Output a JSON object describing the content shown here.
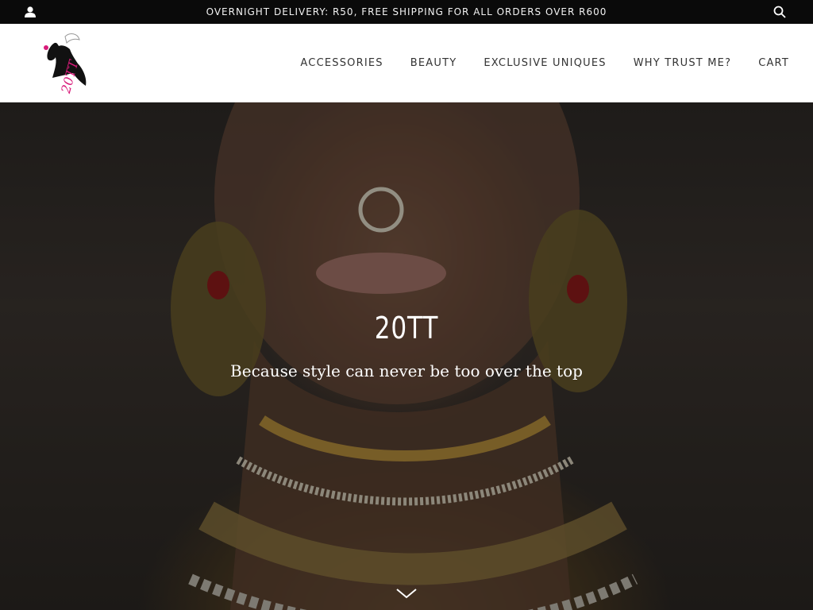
{
  "topbar": {
    "announcement": "OVERNIGHT DELIVERY: R50, FREE SHIPPING FOR ALL ORDERS OVER R600",
    "account_icon": "user-icon",
    "search_icon": "search-icon"
  },
  "header": {
    "logo_text": "20TT",
    "nav": [
      "ACCESSORIES",
      "BEAUTY",
      "EXCLUSIVE UNIQUES",
      "WHY TRUST ME?",
      "CART"
    ]
  },
  "hero": {
    "title": "20TT",
    "subtitle": "Because style can never be too over the top",
    "scroll_icon": "chevron-down-icon"
  },
  "colors": {
    "topbar_bg": "#0a0a0a",
    "header_bg": "#ffffff",
    "logo_accent": "#d81b7a"
  }
}
